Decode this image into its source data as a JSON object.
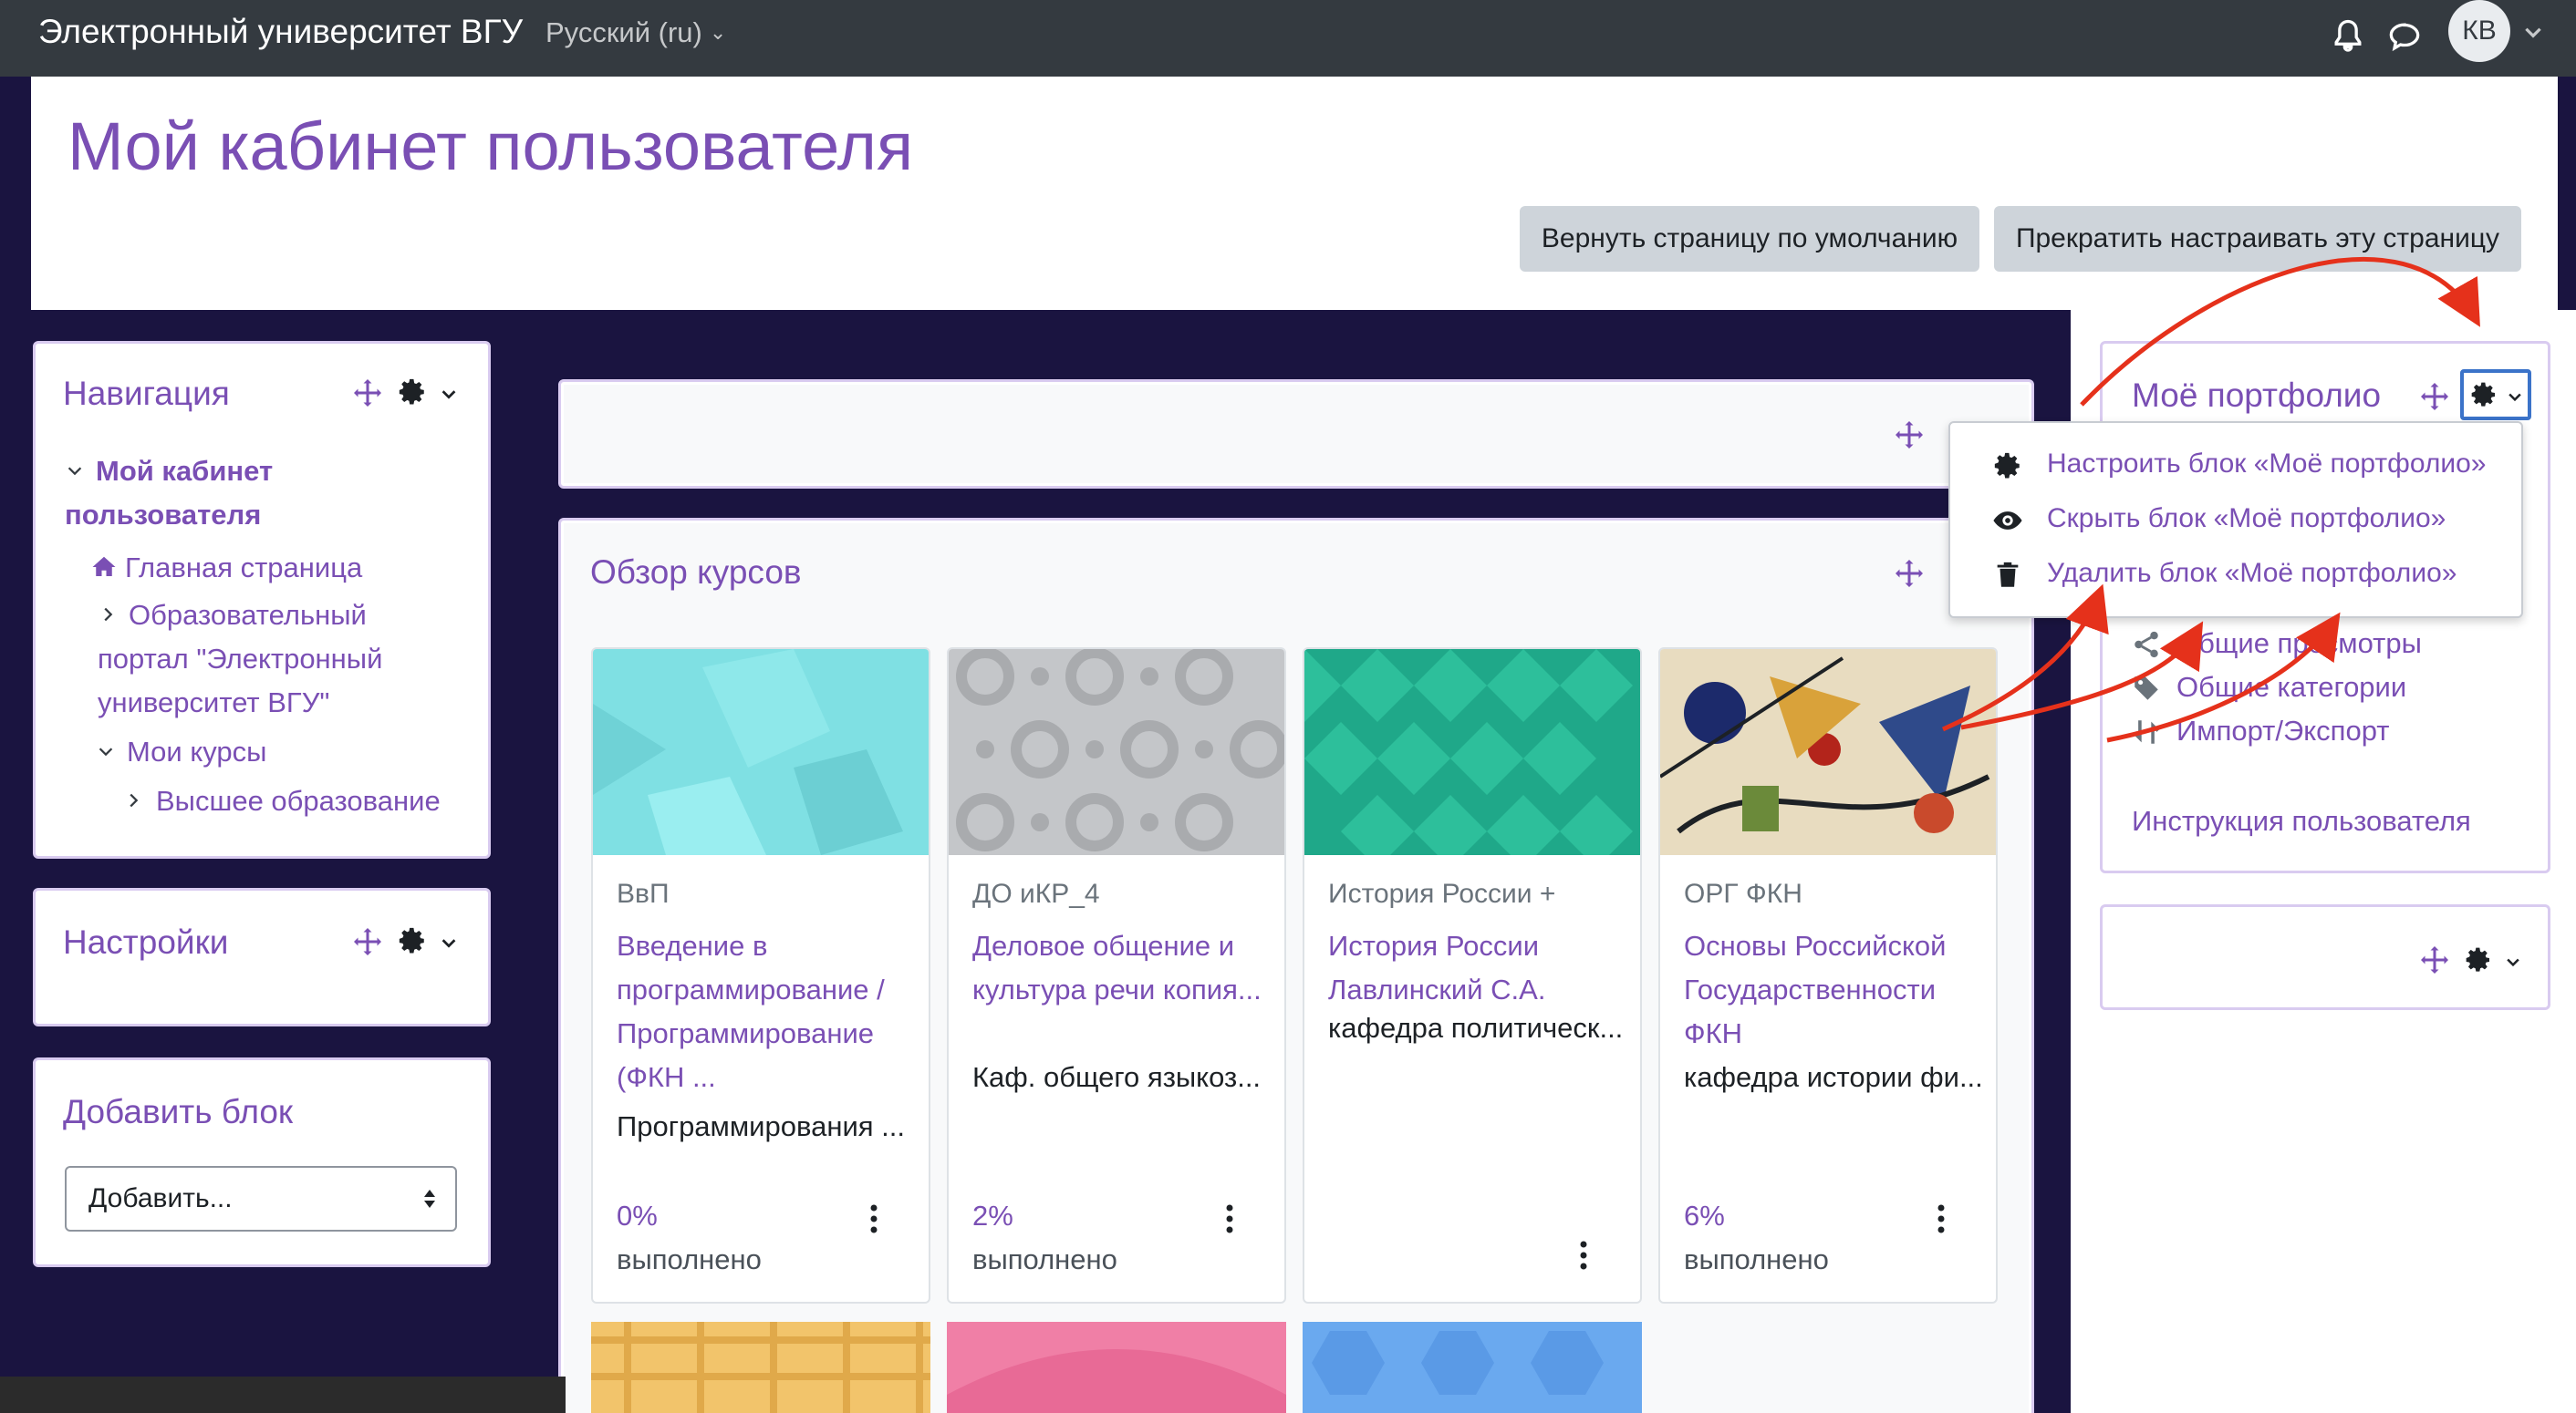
{
  "topbar": {
    "site_name": "Электронный университет ВГУ",
    "language": "Русский (ru)",
    "avatar_initials": "КВ"
  },
  "header": {
    "title": "Мой кабинет пользователя",
    "reset_button": "Вернуть страницу по умолчанию",
    "stop_customizing_button": "Прекратить настраивать эту страницу"
  },
  "navigation": {
    "title": "Навигация",
    "items": [
      {
        "label": "Мой кабинет пользователя",
        "bold": true
      },
      {
        "label": "Главная страница"
      },
      {
        "label": "Образовательный портал \"Электронный университет ВГУ\""
      },
      {
        "label": "Мои курсы"
      },
      {
        "label": "Высшее образование"
      }
    ]
  },
  "settings_block": {
    "title": "Настройки"
  },
  "add_block": {
    "title": "Добавить блок",
    "select_value": "Добавить..."
  },
  "courses_overview": {
    "title": "Обзор курсов",
    "courses": [
      {
        "category": "ВвП",
        "name": "Введение в программирование / Программирование (ФКН ...",
        "dept": "Программирования ...",
        "progress_pct": "0%",
        "progress_label": "выполнено"
      },
      {
        "category": "ДО иКР_4",
        "name": "Деловое общение и культура речи копия...",
        "dept": "Каф. общего языкоз...",
        "progress_pct": "2%",
        "progress_label": "выполнено"
      },
      {
        "category": "История России +",
        "name": "История России Лавлинский С.А.",
        "dept": "кафедра политическ...",
        "progress_pct": "",
        "progress_label": ""
      },
      {
        "category": "ОРГ ФКН",
        "name": "Основы Российской Государственности ФКН",
        "dept": "кафедра истории фи...",
        "progress_pct": "6%",
        "progress_label": "выполнено"
      }
    ]
  },
  "portfolio": {
    "title": "Моё портфолио",
    "menu": [
      {
        "label": "Настроить блок «Моё портфолио»",
        "icon": "gear-icon"
      },
      {
        "label": "Скрыть блок «Моё портфолио»",
        "icon": "eye-icon"
      },
      {
        "label": "Удалить блок «Моё портфолио»",
        "icon": "trash-icon"
      }
    ],
    "links": [
      {
        "label": "Общие просмотры",
        "icon": "share-icon"
      },
      {
        "label": "Общие категории",
        "icon": "tags-icon"
      },
      {
        "label": "Импорт/Экспорт",
        "icon": "transfer-icon"
      }
    ],
    "instruction_link": "Инструкция пользователя"
  },
  "colors": {
    "accent": "#7a4fb4",
    "topbar": "#343a40",
    "page_bg": "#1a1440",
    "annotation_arrow": "#e5311b"
  }
}
